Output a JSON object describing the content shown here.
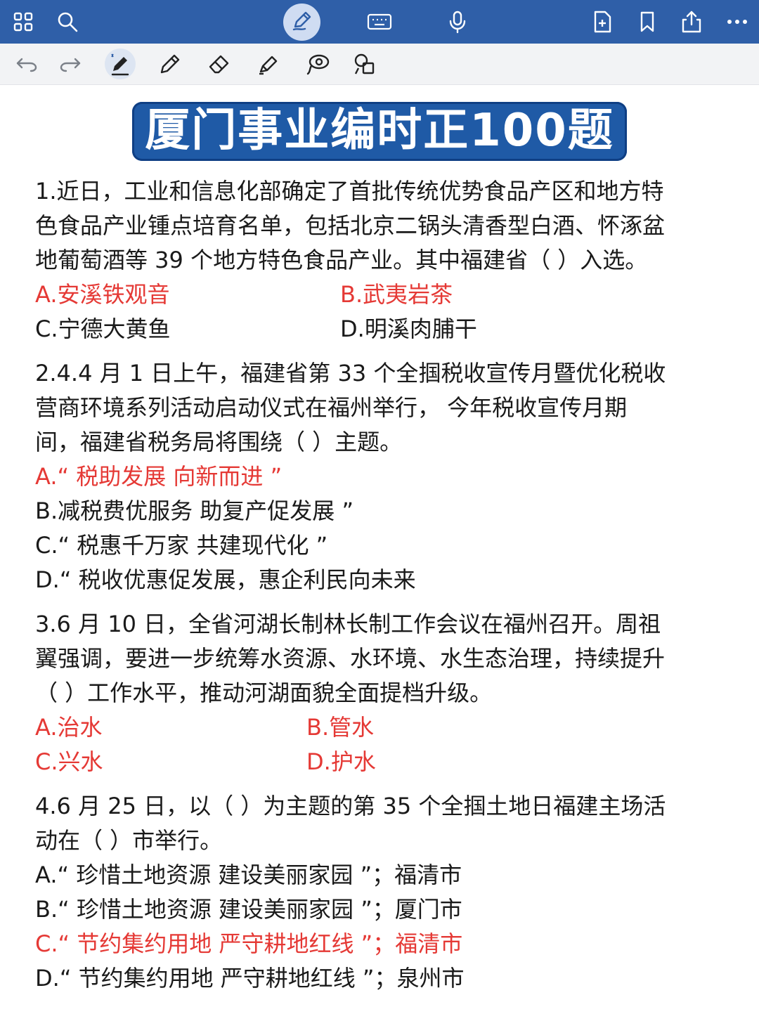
{
  "title": "厦门事业编时正100题",
  "questions": [
    {
      "lines": [
        "1.近日，工业和信息化部确定了首批传统优势食品产区和地方特",
        "色食品产业锺点培育名单，包括北京二锅头清香型白酒、怀涿盆",
        "地葡萄酒等 39 个地方特色食品产业。其中福建省（ ）入选。"
      ],
      "options": [
        "A.安溪铁观音",
        "B.武夷岩茶",
        "C.宁德大黄鱼",
        "D.明溪肉脯干"
      ]
    },
    {
      "lines": [
        "2.4.4 月 1 日上午，福建省第 33 个全掴税收宣传月暨优化税收",
        "营商环境系列活动启动仪式在福州举行， 今年税收宣传月期",
        "间，福建省税务局将围绕（ ）主题。"
      ],
      "options": [
        "A.“ 税助发展 向新而进 ”",
        "B.减税费优服务 助复产促发展 ”",
        "C.“ 税惠千万家 共建现代化 ”",
        "D.“ 税收优惠促发展，惠企利民向未来"
      ]
    },
    {
      "lines": [
        "3.6 月 10 日，全省河湖长制林长制工作会议在福州召开。周祖",
        "翼强调，要进一步统筹水资源、水环境、水生态治理，持续提升",
        "（ ）工作水平，推动河湖面貌全面提档升级。"
      ],
      "options": [
        "A.治水",
        "B.管水",
        "C.兴水",
        "D.护水"
      ]
    },
    {
      "lines": [
        "4.6 月 25 日，以（ ）为主题的第 35 个全掴土地日福建主场活",
        "动在（ ）市举行。"
      ],
      "options": [
        "A.“ 珍惜土地资源 建设美丽家园 ”；福清市",
        "B.“ 珍惜土地资源 建设美丽家园 ”；厦门市",
        "C.“ 节约集约用地 严守耕地红线 ”；福清市",
        "D.“ 节约集约用地 严守耕地红线 ”；泉州市"
      ]
    }
  ],
  "colors": {
    "topbar": "#2f5fa8",
    "title_bg": "#1f5aa6",
    "answer_red": "#e53935"
  },
  "icons": {
    "topbar": [
      "grid-icon",
      "search-icon",
      "pen-mode-icon",
      "keyboard-icon",
      "microphone-icon",
      "add-page-icon",
      "bookmark-icon",
      "share-icon",
      "more-icon"
    ],
    "toolbar": [
      "undo-icon",
      "redo-icon",
      "stylus-icon",
      "pencil-icon",
      "eraser-icon",
      "highlighter-icon",
      "lasso-icon",
      "shapes-icon"
    ]
  }
}
